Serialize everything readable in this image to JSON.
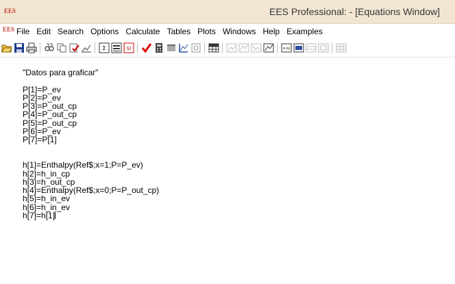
{
  "window": {
    "title": "EES Professional:  - [Equations Window]",
    "app_icon_text": "EES"
  },
  "menubar": {
    "items": [
      "File",
      "Edit",
      "Search",
      "Options",
      "Calculate",
      "Tables",
      "Plots",
      "Windows",
      "Help",
      "Examples"
    ]
  },
  "toolbar": {
    "icons": [
      "open-icon",
      "save-icon",
      "print-icon",
      "find-icon",
      "copy-icon",
      "check-icon",
      "chart-icon",
      "formatted-equations-icon",
      "solution-icon",
      "arrays-icon",
      "solve-check-icon",
      "calculator-icon",
      "parametric-table-icon",
      "plot-icon",
      "diagram-icon",
      "lookup-table-icon",
      "plot-window-icon",
      "plot-window-2-icon",
      "plot-window-3-icon",
      "plot-window-4-icon",
      "xy-icon",
      "xy-2-icon",
      "table-icon",
      "table-2-icon",
      "grid-icon"
    ]
  },
  "editor": {
    "lines": [
      "\"Datos para graficar\"",
      "",
      "P[1]=P_ev",
      "P[2]=P_ev",
      "P[3]=P_out_cp",
      "P[4]=P_out_cp",
      "P[5]=P_out_cp",
      "P[6]=P_ev",
      "P[7]=P[1]",
      "",
      "",
      "h[1]=Enthalpy(Ref$;x=1;P=P_ev)",
      "h[2]=h_in_cp",
      "h[3]=h_out_cp",
      "h[4]=Enthalpy(Ref$;x=0;P=P_out_cp)",
      "h[5]=h_in_ev",
      "h[6]=h_in_ev",
      "h[7]=h[1]"
    ]
  }
}
